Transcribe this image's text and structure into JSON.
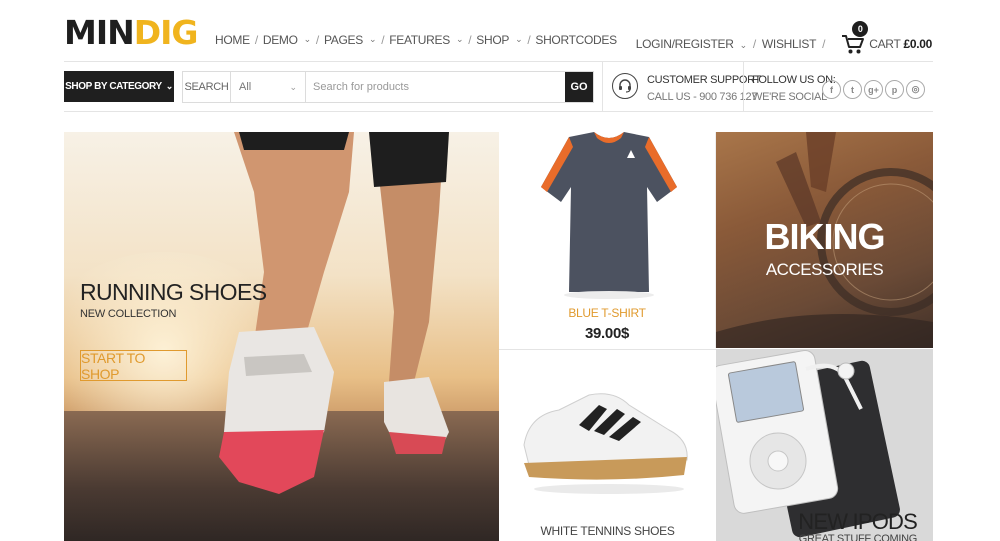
{
  "brand": {
    "logo_part1": "MIN",
    "logo_part2": "DIG"
  },
  "nav": {
    "items": [
      {
        "label": "Home",
        "has_dropdown": false
      },
      {
        "label": "Demo",
        "has_dropdown": true
      },
      {
        "label": "Pages",
        "has_dropdown": true
      },
      {
        "label": "Features",
        "has_dropdown": true
      },
      {
        "label": "Shop",
        "has_dropdown": true
      },
      {
        "label": "Shortcodes",
        "has_dropdown": false
      }
    ],
    "separator": "/"
  },
  "account": {
    "login_label": "Login/Register",
    "wishlist_label": "Wishlist",
    "cart_label": "Cart",
    "cart_total": "£0.00",
    "cart_count": "0"
  },
  "search": {
    "category_button": "Shop by category",
    "label": "Search",
    "select_value": "All",
    "placeholder": "Search for products",
    "go_label": "GO"
  },
  "support": {
    "title": "Customer Support",
    "subtitle": "Call us - 900 736 127"
  },
  "follow": {
    "title": "Follow us on:",
    "subtitle": "We're social",
    "icons": [
      "facebook-icon",
      "twitter-icon",
      "google-plus-icon",
      "pinterest-icon",
      "instagram-icon"
    ],
    "glyphs": [
      "f",
      "t",
      "g+",
      "p",
      "◎"
    ]
  },
  "banners": {
    "hero": {
      "title": "Running Shoes",
      "subtitle": "New collection",
      "button": "Start to shop"
    },
    "tshirt": {
      "name": "Blue T-Shirt",
      "price": "39.00$"
    },
    "shoe": {
      "name": "White Tennins Shoes"
    },
    "bike": {
      "title": "BIKING",
      "subtitle": "ACCESSORIES"
    },
    "ipod": {
      "title": "New iPods",
      "subtitle": "Great stuff coming"
    }
  },
  "colors": {
    "accent": "#e09a2e",
    "logo_yellow": "#f0b41e",
    "dark": "#1f1f1f"
  }
}
